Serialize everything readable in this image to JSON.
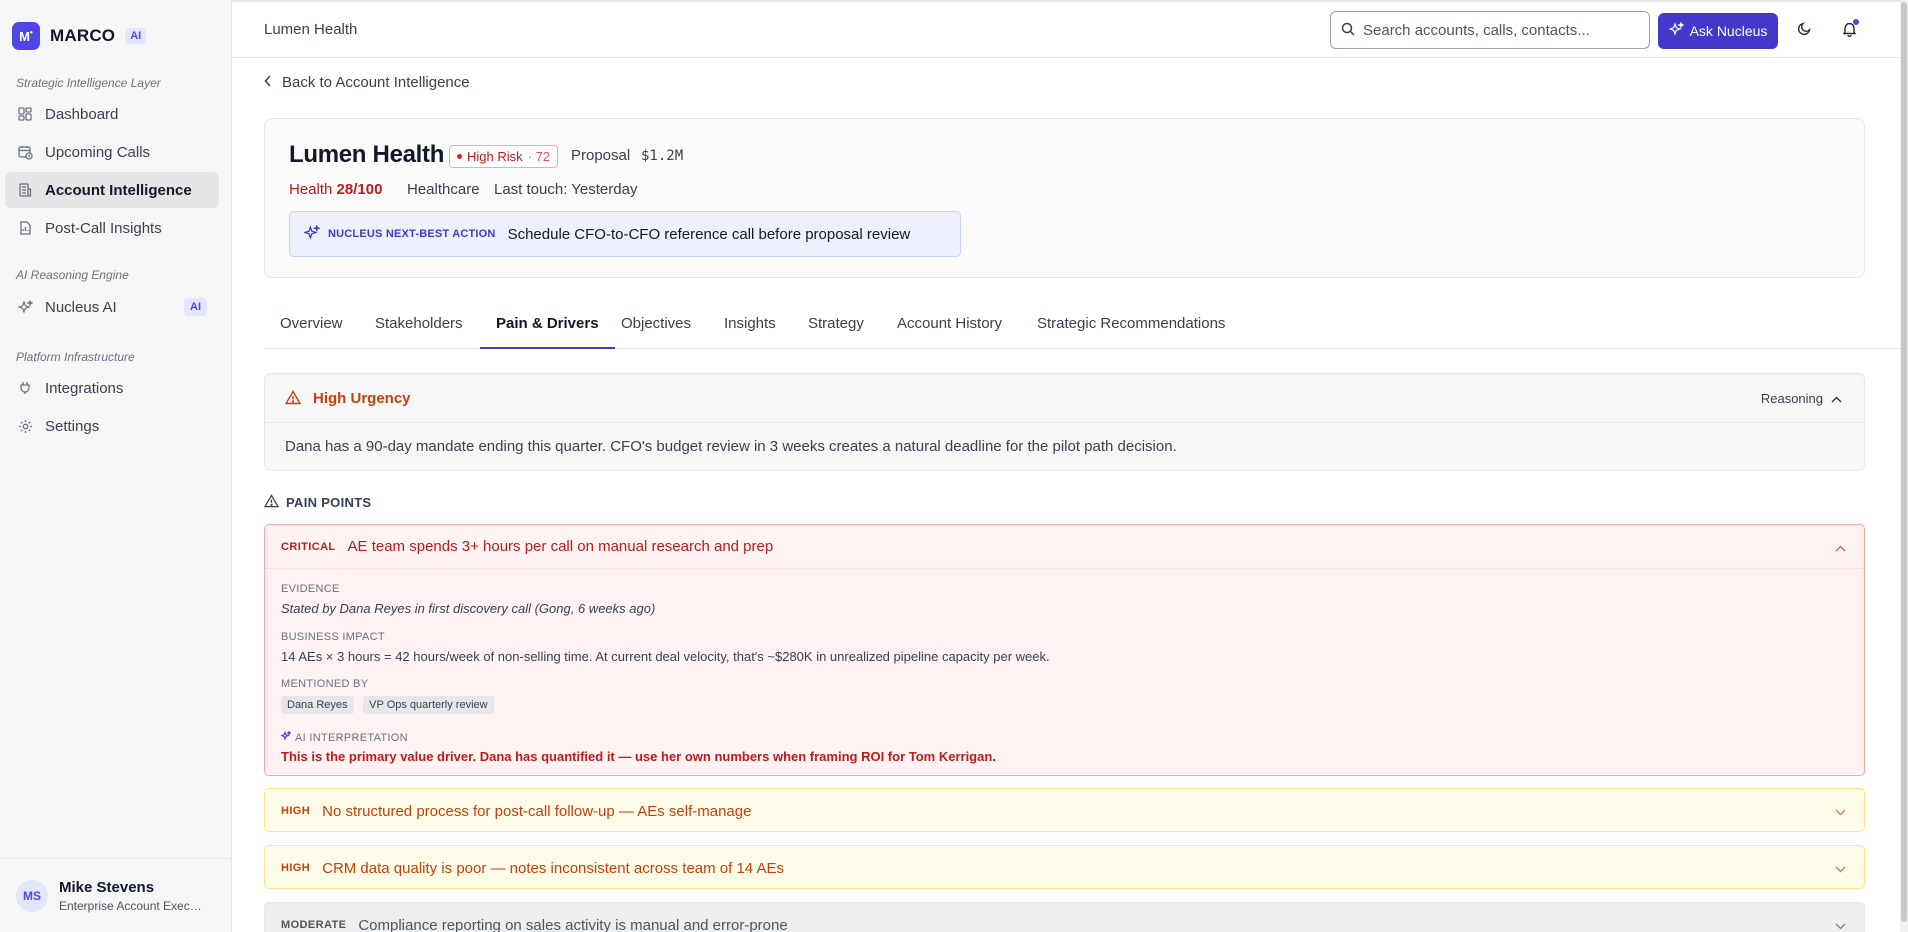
{
  "sidebar": {
    "brand_logo": "M",
    "brand_name": "MARCO",
    "brand_ai": "AI",
    "sections": [
      "Strategic Intelligence Layer",
      "AI Reasoning Engine",
      "Platform Infrastructure"
    ],
    "items": [
      {
        "label": "Dashboard"
      },
      {
        "label": "Upcoming Calls"
      },
      {
        "label": "Account Intelligence"
      },
      {
        "label": "Post-Call Insights"
      },
      {
        "label": "Nucleus AI",
        "badge": "AI"
      },
      {
        "label": "Integrations"
      },
      {
        "label": "Settings"
      }
    ],
    "user": {
      "initials": "MS",
      "name": "Mike Stevens",
      "role": "Enterprise Account Executive"
    }
  },
  "topbar": {
    "title": "Lumen Health",
    "search_placeholder": "Search accounts, calls, contacts...",
    "ask_label": "Ask Nucleus"
  },
  "account": {
    "back_label": "Back to Account Intelligence",
    "name": "Lumen Health",
    "risk_label": "High Risk",
    "risk_score": "· 72",
    "stage": "Proposal",
    "amount": "$1.2M",
    "health_label": "Health",
    "health_value": "28/100",
    "industry": "Healthcare",
    "last_touch": "Last touch: Yesterday",
    "nba_label": "NUCLEUS NEXT-BEST ACTION",
    "nba_text": "Schedule CFO-to-CFO reference call before proposal review"
  },
  "tabs": [
    {
      "label": "Overview"
    },
    {
      "label": "Stakeholders"
    },
    {
      "label": "Pain & Drivers"
    },
    {
      "label": "Objectives"
    },
    {
      "label": "Insights"
    },
    {
      "label": "Strategy"
    },
    {
      "label": "Account History"
    },
    {
      "label": "Strategic Recommendations"
    }
  ],
  "urgency": {
    "title": "High Urgency",
    "reasoning_label": "Reasoning",
    "body": "Dana has a 90-day mandate ending this quarter. CFO's budget review in 3 weeks creates a natural deadline for the pilot path decision."
  },
  "pain_points": {
    "header": "PAIN POINTS",
    "items": [
      {
        "severity": "CRITICAL",
        "title": "AE team spends 3+ hours per call on manual research and prep",
        "evidence_label": "EVIDENCE",
        "evidence": "Stated by Dana Reyes in first discovery call (Gong, 6 weeks ago)",
        "impact_label": "BUSINESS IMPACT",
        "impact": "14 AEs × 3 hours = 42 hours/week of non-selling time. At current deal velocity, that's ~$280K in unrealized pipeline capacity per week.",
        "mentioned_label": "MENTIONED BY",
        "mentioned": [
          "Dana Reyes",
          "VP Ops quarterly review"
        ],
        "ai_label": "AI INTERPRETATION",
        "ai": "This is the primary value driver. Dana has quantified it — use her own numbers when framing ROI for Tom Kerrigan."
      },
      {
        "severity": "HIGH",
        "title": "No structured process for post-call follow-up — AEs self-manage"
      },
      {
        "severity": "HIGH",
        "title": "CRM data quality is poor — notes inconsistent across team of 14 AEs"
      },
      {
        "severity": "MODERATE",
        "title": "Compliance reporting on sales activity is manual and error-prone"
      }
    ]
  }
}
